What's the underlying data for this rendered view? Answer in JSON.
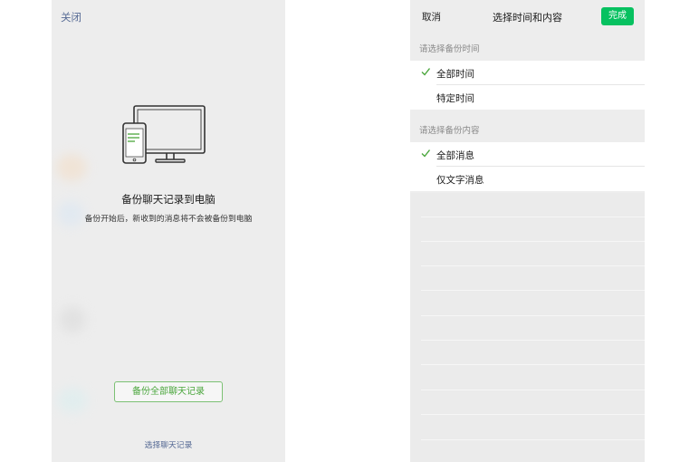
{
  "left_screen": {
    "close_label": "关闭",
    "illustration_icon": "phone-monitor-icon",
    "title": "备份聊天记录到电脑",
    "subtitle": "备份开始后，新收到的消息将不会被备份到电脑",
    "backup_all_button": "备份全部聊天记录",
    "select_records_link": "选择聊天记录"
  },
  "right_screen": {
    "nav": {
      "cancel_label": "取消",
      "title": "选择时间和内容",
      "done_label": "完成"
    },
    "time_section": {
      "header": "请选择备份时间",
      "options": [
        {
          "label": "全部时间",
          "selected": true
        },
        {
          "label": "特定时间",
          "selected": false
        }
      ]
    },
    "content_section": {
      "header": "请选择备份内容",
      "options": [
        {
          "label": "全部消息",
          "selected": true
        },
        {
          "label": "仅文字消息",
          "selected": false
        }
      ]
    }
  },
  "colors": {
    "link_blue": "#576b95",
    "wechat_green": "#07c160",
    "check_green": "#4aa63c",
    "background_gray": "#ededed"
  }
}
